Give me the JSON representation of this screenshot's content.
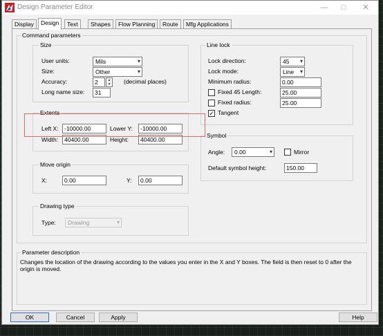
{
  "window": {
    "title": "Design Parameter Editor",
    "minimize": "—",
    "maximize": "□",
    "close": "✕"
  },
  "tabs": [
    "Display",
    "Design",
    "Text",
    "Shapes",
    "Flow Planning",
    "Route",
    "Mfg Applications"
  ],
  "active_tab": "Design",
  "command_parameters": {
    "title": "Command parameters",
    "size": {
      "title": "Size",
      "user_units_label": "User units:",
      "user_units_value": "Mils",
      "size_label": "Size:",
      "size_value": "Other",
      "accuracy_label": "Accuracy:",
      "accuracy_value": "2",
      "accuracy_note": "(decimal places)",
      "long_name_label": "Long name size:",
      "long_name_value": "31"
    },
    "extents": {
      "title": "Extents",
      "left_x_label": "Left X:",
      "left_x_value": "-10000.00",
      "lower_y_label": "Lower Y:",
      "lower_y_value": "-10000.00",
      "width_label": "Width:",
      "width_value": "40400.00",
      "height_label": "Height:",
      "height_value": "40400.00"
    },
    "move_origin": {
      "title": "Move origin",
      "x_label": "X:",
      "x_value": "0.00",
      "y_label": "Y:",
      "y_value": "0.00"
    },
    "drawing_type": {
      "title": "Drawing type",
      "type_label": "Type:",
      "type_value": "Drawing"
    },
    "line_lock": {
      "title": "Line lock",
      "lock_direction_label": "Lock direction:",
      "lock_direction_value": "45",
      "lock_mode_label": "Lock mode:",
      "lock_mode_value": "Line",
      "min_radius_label": "Minimum radius:",
      "min_radius_value": "0.00",
      "fixed45_label": "Fixed 45 Length:",
      "fixed45_value": "25.00",
      "fixed45_checked": false,
      "fixed_radius_label": "Fixed radius:",
      "fixed_radius_value": "25.00",
      "fixed_radius_checked": false,
      "tangent_label": "Tangent",
      "tangent_checked": true
    },
    "symbol": {
      "title": "Symbol",
      "angle_label": "Angle:",
      "angle_value": "0.00",
      "mirror_label": "Mirror",
      "mirror_checked": false,
      "default_height_label": "Default symbol height:",
      "default_height_value": "150.00"
    }
  },
  "parameter_description": {
    "title": "Parameter description",
    "text": "Changes the location of the drawing according to the values you enter in the X and Y boxes. The field is then reset to 0 after the origin is moved."
  },
  "buttons": {
    "ok": "OK",
    "cancel": "Cancel",
    "apply": "Apply",
    "help": "Help"
  },
  "icons": {
    "app": "app-logo-icon",
    "dropdown": "chevron-down-icon",
    "spin_up": "spin-up-icon",
    "spin_down": "spin-down-icon",
    "check": "checkmark-icon"
  },
  "colors": {
    "highlight_box": "#e06a6a",
    "default_button_border": "#2b6fd1"
  }
}
